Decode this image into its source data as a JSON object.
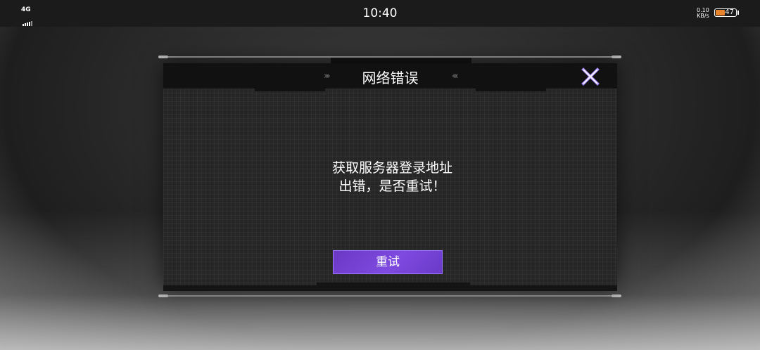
{
  "status_bar": {
    "network": "4G",
    "time": "10:40",
    "speed_value": "0.10",
    "speed_unit": "KB/s",
    "battery": "47",
    "battery_level": 0.47
  },
  "dialog": {
    "title": "网络错误",
    "chevrons_left": "›››",
    "chevrons_right": "‹‹‹",
    "close_icon": "close-x-icon",
    "message_line1": "获取服务器登录地址",
    "message_line2": "出错，是否重试！",
    "retry_label": "重试"
  },
  "colors": {
    "accent": "#7445d6",
    "close_icon": "#a98bff"
  }
}
